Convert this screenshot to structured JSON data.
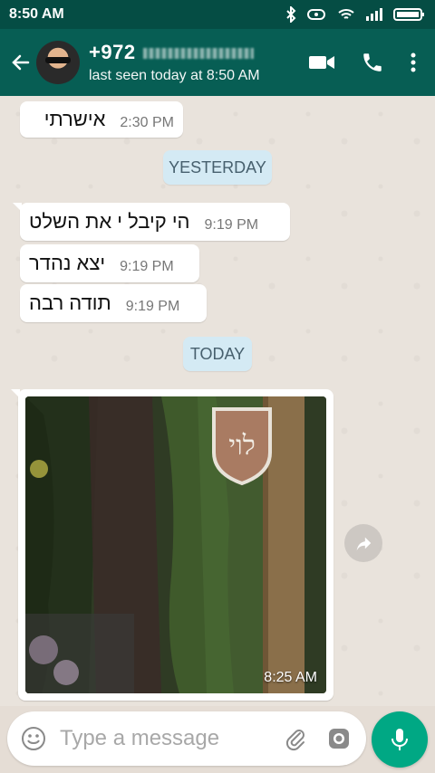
{
  "status_bar": {
    "time": "8:50 AM"
  },
  "contact": {
    "name": "+972",
    "status": "last seen today at 8:50 AM"
  },
  "messages": [
    {
      "text": "אישרתי",
      "time": "2:30 PM"
    },
    {
      "date": "YESTERDAY"
    },
    {
      "text": "הי קיבל י את השלט",
      "time": "9:19 PM"
    },
    {
      "text": "יצא נהדר",
      "time": "9:19 PM"
    },
    {
      "text": "תודה רבה",
      "time": "9:19 PM"
    },
    {
      "date": "TODAY"
    }
  ],
  "image_message": {
    "time": "8:25 AM",
    "sign_text": "לוי"
  },
  "composer": {
    "placeholder": "Type a message"
  },
  "colors": {
    "header": "#075e54",
    "statusbar": "#054d44",
    "accent": "#00a884"
  }
}
